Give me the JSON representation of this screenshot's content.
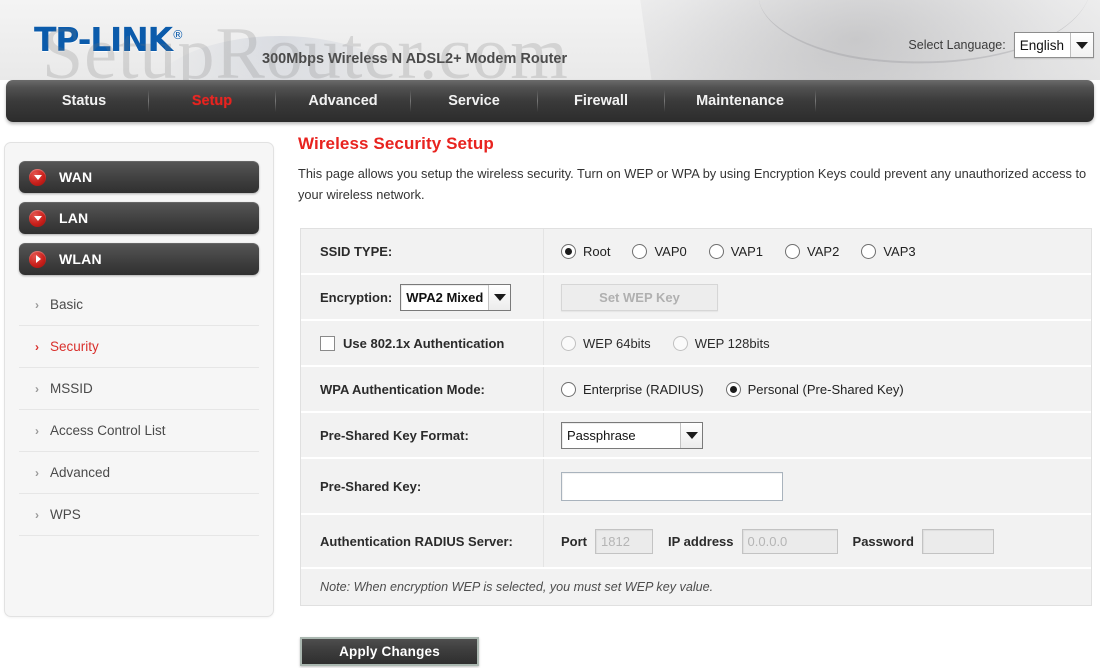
{
  "header": {
    "logo_text": "TP-LINK",
    "logo_reg": "®",
    "model": "300Mbps Wireless N ADSL2+ Modem Router",
    "language_label": "Select Language:",
    "language_value": "English",
    "watermark": "SetupRouter.com"
  },
  "nav": {
    "items": [
      {
        "label": "Status",
        "active": false
      },
      {
        "label": "Setup",
        "active": true
      },
      {
        "label": "Advanced",
        "active": false
      },
      {
        "label": "Service",
        "active": false
      },
      {
        "label": "Firewall",
        "active": false
      },
      {
        "label": "Maintenance",
        "active": false
      }
    ]
  },
  "sidebar": {
    "groups": [
      {
        "label": "WAN",
        "icon": "chevron-down-icon"
      },
      {
        "label": "LAN",
        "icon": "chevron-down-icon"
      },
      {
        "label": "WLAN",
        "icon": "chevron-right-icon"
      }
    ],
    "items": [
      {
        "label": "Basic",
        "active": false,
        "marker": "›"
      },
      {
        "label": "Security",
        "active": true,
        "marker": "›"
      },
      {
        "label": "MSSID",
        "active": false,
        "marker": "›"
      },
      {
        "label": "Access Control List",
        "active": false,
        "marker": "›"
      },
      {
        "label": "Advanced",
        "active": false,
        "marker": "›"
      },
      {
        "label": "WPS",
        "active": false,
        "marker": "›"
      }
    ]
  },
  "page": {
    "title": "Wireless Security Setup",
    "description": "This page allows you setup the wireless security. Turn on WEP or WPA by using Encryption Keys could prevent any unauthorized access to your wireless network."
  },
  "form": {
    "ssid_type": {
      "label": "SSID TYPE:",
      "options": [
        "Root",
        "VAP0",
        "VAP1",
        "VAP2",
        "VAP3"
      ],
      "selected": "Root"
    },
    "encryption": {
      "label": "Encryption:",
      "value": "WPA2 Mixed",
      "set_wep_key_button": "Set WEP Key"
    },
    "dot1x": {
      "label": "Use 802.1x Authentication",
      "checked": false,
      "options": [
        "WEP 64bits",
        "WEP 128bits"
      ],
      "selected": ""
    },
    "wpa_auth_mode": {
      "label": "WPA Authentication Mode:",
      "options": [
        "Enterprise (RADIUS)",
        "Personal (Pre-Shared Key)"
      ],
      "selected": "Personal (Pre-Shared Key)"
    },
    "psk_format": {
      "label": "Pre-Shared Key Format:",
      "value": "Passphrase"
    },
    "psk": {
      "label": "Pre-Shared Key:",
      "value": ""
    },
    "radius": {
      "label": "Authentication RADIUS Server:",
      "port_label": "Port",
      "port_value": "1812",
      "ip_label": "IP address",
      "ip_value": "0.0.0.0",
      "password_label": "Password",
      "password_value": ""
    },
    "note": "Note: When encryption WEP is selected, you must set WEP key value.",
    "apply_button": "Apply Changes"
  },
  "colors": {
    "brand_blue": "#0b5bab",
    "accent_red": "#e8231f",
    "nav_dark": "#3a3a3a"
  }
}
